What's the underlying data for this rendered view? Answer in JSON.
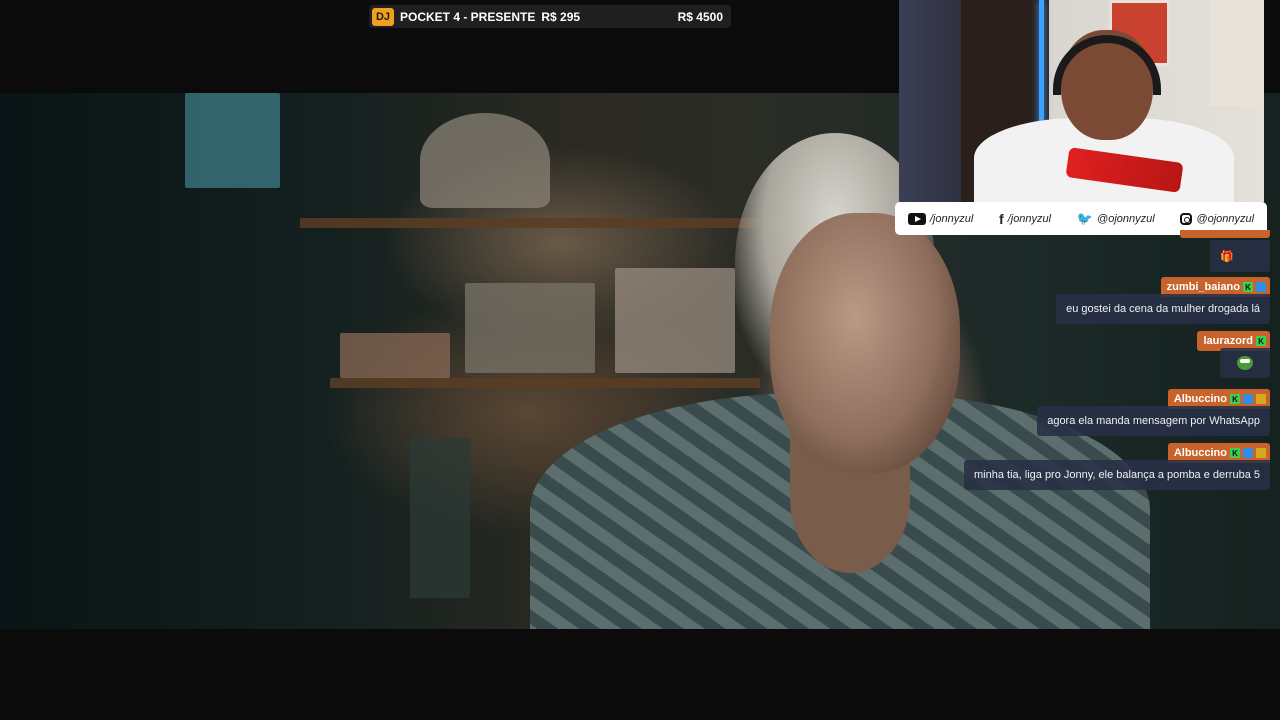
{
  "donation_bar": {
    "badge": "DJ",
    "item": "POCKET 4 - PRESENTE",
    "price": "R$ 295",
    "goal": "R$ 4500"
  },
  "socials": [
    {
      "icon": "youtube-icon",
      "handle": "/jonnyzul"
    },
    {
      "icon": "facebook-icon",
      "handle": "/jonnyzul"
    },
    {
      "icon": "twitter-icon",
      "handle": "@ojonnyzul"
    },
    {
      "icon": "instagram-icon",
      "handle": "@ojonnyzul"
    }
  ],
  "chat": {
    "first_msg": "🎁",
    "messages": [
      {
        "user": "zumbi_baiano",
        "text": "eu gostei da cena da mulher drogada lá"
      },
      {
        "user": "laurazord",
        "text": ""
      },
      {
        "user": "Albuccino",
        "text": "agora ela manda mensagem por WhatsApp"
      },
      {
        "user": "Albuccino",
        "text": "minha tia, liga pro Jonny, ele balança a pomba e derruba 5"
      }
    ]
  },
  "colors": {
    "name_tag": "#c8632b",
    "msg_bg": "#283046",
    "dj_badge": "#f0a020"
  }
}
